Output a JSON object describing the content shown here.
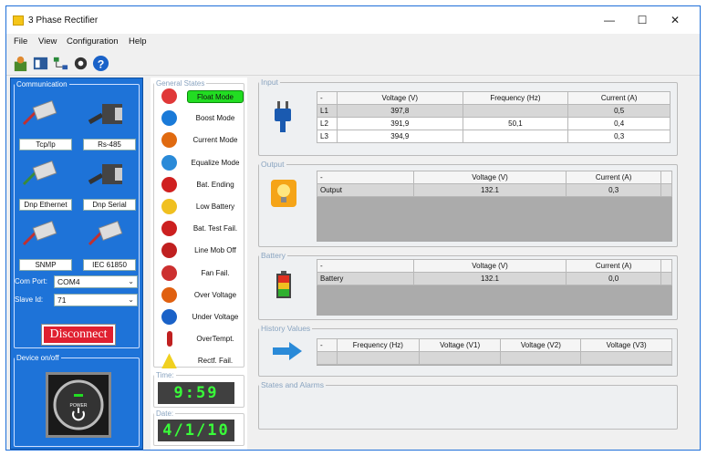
{
  "window": {
    "title": "3 Phase Rectifier",
    "minimize": "—",
    "maximize": "☐",
    "close": "✕"
  },
  "menu": [
    "File",
    "View",
    "Configuration",
    "Help"
  ],
  "communication": {
    "legend": "Communication",
    "protocols": [
      "Tcp/Ip",
      "Rs-485",
      "Dnp Ethernet",
      "Dnp Serial",
      "SNMP",
      "IEC 61850"
    ],
    "com_port_label": "Com Port:",
    "com_port_value": "COM4",
    "slave_id_label": "Slave Id:",
    "slave_id_value": "71",
    "disconnect_label": "Disconnect"
  },
  "device": {
    "legend": "Device on/off",
    "power_label": "POWER"
  },
  "general_states": {
    "legend": "General States",
    "items": [
      "Float Mode",
      "Boost Mode",
      "Current Mode",
      "Equalize Mode",
      "Bat. Ending",
      "Low Battery",
      "Bat. Test Fail.",
      "Line Mob Off",
      "Fan Fail.",
      "Over Voltage",
      "Under Voltage",
      "OverTempt.",
      "Rectf. Fail."
    ],
    "active": "Float Mode"
  },
  "time": {
    "legend": "Time:",
    "value": "9:59"
  },
  "date": {
    "legend": "Date:",
    "value": "4/1/10"
  },
  "input": {
    "legend": "Input",
    "headers": [
      "-",
      "Voltage (V)",
      "Frequency (Hz)",
      "Current (A)"
    ],
    "rows": [
      [
        "L1",
        "397,8",
        "",
        "0,5"
      ],
      [
        "L2",
        "391,9",
        "50,1",
        "0,4"
      ],
      [
        "L3",
        "394,9",
        "",
        "0,3"
      ]
    ]
  },
  "output": {
    "legend": "Output",
    "headers": [
      "-",
      "Voltage (V)",
      "Current (A)"
    ],
    "rows": [
      [
        "Output",
        "132.1",
        "0,3"
      ]
    ]
  },
  "battery": {
    "legend": "Battery",
    "headers": [
      "-",
      "Voltage (V)",
      "Current (A)"
    ],
    "rows": [
      [
        "Battery",
        "132.1",
        "0,0"
      ]
    ]
  },
  "history": {
    "legend": "History Values",
    "headers": [
      "-",
      "Frequency (Hz)",
      "Voltage (V1)",
      "Voltage (V2)",
      "Voltage (V3)"
    ]
  },
  "alarms": {
    "legend": "States and Alarms"
  },
  "colors": {
    "panel_blue": "#1e73d8",
    "active_green": "#22dd22",
    "lcd_green": "#39ff39",
    "disconnect_red": "#e02030"
  }
}
